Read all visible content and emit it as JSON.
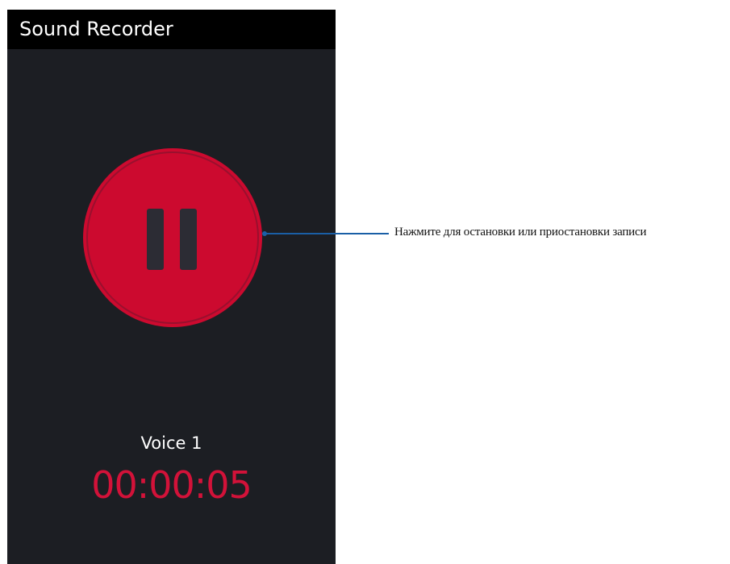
{
  "app": {
    "title": "Sound Recorder"
  },
  "recorder": {
    "button_icon": "pause-icon",
    "button_color": "#cc0a2f",
    "file_name": "Voice 1",
    "elapsed_time": "00:00:05",
    "elapsed_time_color": "#d21239"
  },
  "callout": {
    "text": "Нажмите для остановки или приостановки записи",
    "line_color": "#1a5fa6"
  }
}
